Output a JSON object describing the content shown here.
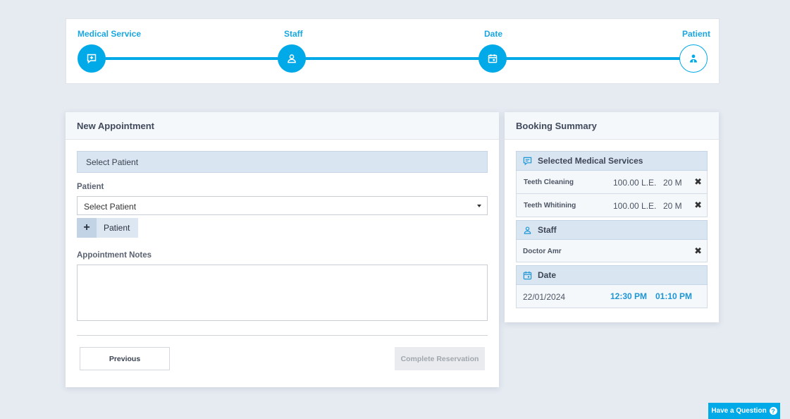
{
  "stepper": {
    "steps": [
      {
        "label": "Medical Service",
        "icon": "message-plus-icon"
      },
      {
        "label": "Staff",
        "icon": "user-icon"
      },
      {
        "label": "Date",
        "icon": "calendar-icon"
      },
      {
        "label": "Patient",
        "icon": "patient-icon"
      }
    ]
  },
  "appointment": {
    "title": "New Appointment",
    "section_title": "Select Patient",
    "patient_label": "Patient",
    "patient_select_value": "Select Patient",
    "add_patient_label": "Patient",
    "notes_label": "Appointment Notes",
    "notes_value": "",
    "previous_label": "Previous",
    "complete_label": "Complete Reservation"
  },
  "summary": {
    "title": "Booking Summary",
    "services_title": "Selected Medical Services",
    "services": [
      {
        "name": "Teeth Cleaning",
        "price": "100.00 L.E.",
        "duration": "20 M"
      },
      {
        "name": "Teeth Whitining",
        "price": "100.00 L.E.",
        "duration": "20 M"
      }
    ],
    "staff_title": "Staff",
    "staff_name": "Doctor Amr",
    "date_title": "Date",
    "date_value": "22/01/2024",
    "time_start": "12:30 PM",
    "time_end": "01:10 PM",
    "remove_glyph": "✖"
  },
  "help": {
    "label": "Have a Question",
    "glyph": "?"
  },
  "colors": {
    "accent": "#00a9e7",
    "background": "#e6ebf2",
    "section": "#d9e6f2"
  }
}
